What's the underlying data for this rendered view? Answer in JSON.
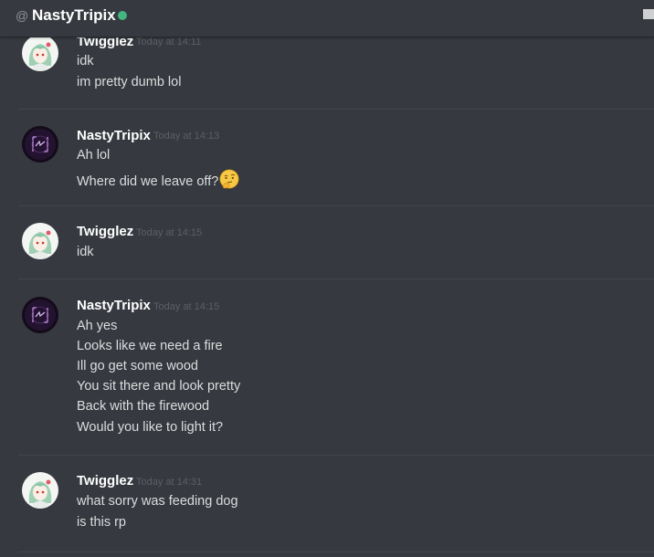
{
  "header": {
    "at_symbol": "@",
    "username": "NastyTripix",
    "status_color": "#43b581"
  },
  "messages": [
    {
      "author": "Twigglez",
      "timestamp": "Today at 14:11",
      "lines": [
        "idk",
        "im pretty dumb lol"
      ],
      "avatar_icon": "anime-avatar-icon"
    },
    {
      "author": "NastyTripix",
      "timestamp": "Today at 14:13",
      "lines": [
        "Ah lol",
        "Where did we leave off?"
      ],
      "emoji_icon": "thinking-face-icon",
      "avatar_icon": "dark-logo-avatar-icon"
    },
    {
      "author": "Twigglez",
      "timestamp": "Today at 14:15",
      "lines": [
        "idk"
      ],
      "avatar_icon": "anime-avatar-icon"
    },
    {
      "author": "NastyTripix",
      "timestamp": "Today at 14:15",
      "lines": [
        "Ah yes",
        "Looks like we need a fire",
        "Ill go get some wood",
        "You sit there and look pretty",
        "Back with the firewood",
        "Would you like to light it?"
      ],
      "avatar_icon": "dark-logo-avatar-icon"
    },
    {
      "author": "Twigglez",
      "timestamp": "Today at 14:31",
      "lines": [
        "what sorry was feeding dog",
        "is this rp"
      ],
      "avatar_icon": "anime-avatar-icon"
    }
  ],
  "colors": {
    "background": "#36393f",
    "text": "#dcddde",
    "username": "#ffffff",
    "timestamp": "#5c5f64"
  }
}
